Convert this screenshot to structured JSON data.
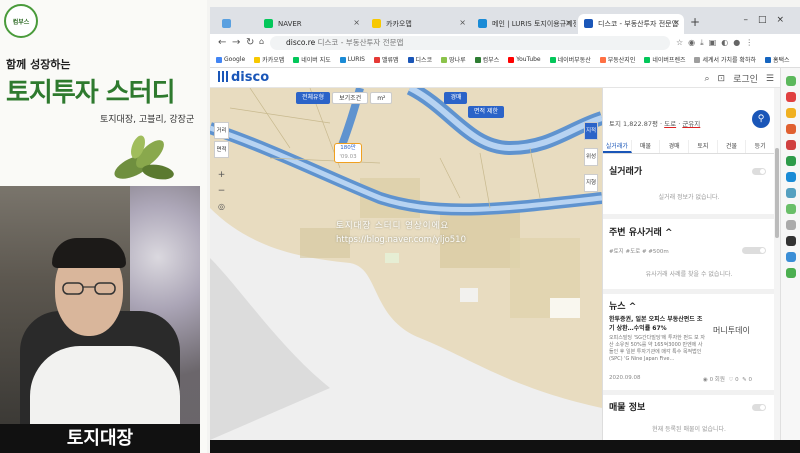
{
  "promo": {
    "logo_text": "컴부스",
    "tagline": "함께 성장하는",
    "title": "토지투자 스터디",
    "subtitle": "토지대장, 고블리, 강장군",
    "caption": "토지대장"
  },
  "browser": {
    "tabs": [
      {
        "label": "",
        "active": false,
        "color": "#5aa0e0"
      },
      {
        "label": "NAVER",
        "active": false,
        "color": "#03c75a"
      },
      {
        "label": "카카오맵",
        "active": false,
        "color": "#f7c800"
      },
      {
        "label": "메인 | LURIS 토지이용규제정보",
        "active": false,
        "color": "#1a8bd6"
      },
      {
        "label": "디스코 - 부동산투자 전문앱",
        "active": true,
        "color": "#1a56b8"
      }
    ],
    "new_tab": "+",
    "address": {
      "host": "disco.re",
      "path": " 디스코 - 부동산투자 전문앱"
    },
    "bookmarks": [
      {
        "label": "Google",
        "color": "#4285f4"
      },
      {
        "label": "카카오맵",
        "color": "#f7c800"
      },
      {
        "label": "네이버 지도",
        "color": "#03c75a"
      },
      {
        "label": "LURIS",
        "color": "#1a8bd6"
      },
      {
        "label": "밸류맵",
        "color": "#e53935"
      },
      {
        "label": "디스코",
        "color": "#1a56b8"
      },
      {
        "label": "땅나루",
        "color": "#8bc34a"
      },
      {
        "label": "컴부스",
        "color": "#2e7d32"
      },
      {
        "label": "YouTube",
        "color": "#ff0000"
      },
      {
        "label": "네이버부동산",
        "color": "#03c75a"
      },
      {
        "label": "부동산지인",
        "color": "#ff7043"
      },
      {
        "label": "네이버프렌즈",
        "color": "#03c75a"
      },
      {
        "label": "세계서 가치를 확하하",
        "color": "#9e9e9e"
      },
      {
        "label": "홈택스",
        "color": "#1565c0"
      }
    ]
  },
  "site": {
    "logo": "disco",
    "login": "로그인",
    "map": {
      "filters": [
        "전체유형",
        "보기조건",
        "m²",
        "경매",
        "면적 제한"
      ],
      "left_buttons": [
        "거리",
        "면적"
      ],
      "zoom_in": "+",
      "zoom_out": "−",
      "right_buttons": [
        "지적",
        "위성",
        "지형"
      ],
      "pin_price": "180만",
      "pin_date": "'09.03",
      "watermark_line1": "토지대장 스터디 영상이에요",
      "watermark_line2": "https://blog.naver.com/yljo510"
    },
    "panel": {
      "address_prefix": "토지 1,822.87평 · ",
      "address_road": "도로",
      "address_mid": " · ",
      "address_zone": "군유지",
      "tabs": [
        "실거래가",
        "매물",
        "경매",
        "토지",
        "건물",
        "등기"
      ],
      "section_trade": "실거래가",
      "trade_empty": "실거래 정보가 없습니다.",
      "section_similar": "주변 유사거래",
      "similar_caret": "^",
      "similar_filter": "#토지 #도로 # #500m",
      "similar_empty": "유사거래 사례를 찾을 수 없습니다.",
      "section_news": "뉴스",
      "news_title": "한투증권, 일본 오피스 부동산펀드 조기 상환…수익률 67%",
      "news_body": "오피스빌딩 'SG간다빌딩'에 투자한 펀드 보 자산 소유권 50%를 약 165억3000 만엔에 사들인 후 일본 투자기관에 매각 특수 목적법인(SPC) 'G Nine Japan Five…",
      "news_source": "머니투데이",
      "news_date": "2020.09.08",
      "news_views": "0 회원",
      "news_likes": "0",
      "news_comments": "0",
      "section_listing": "매물 정보",
      "listing_empty": "현재 등록된 매물이 없습니다."
    }
  },
  "colors": {
    "brand": "#1a56b8",
    "green_title": "#2e7a2e",
    "road": "#5f93cf",
    "land": "#e8dcc0"
  }
}
